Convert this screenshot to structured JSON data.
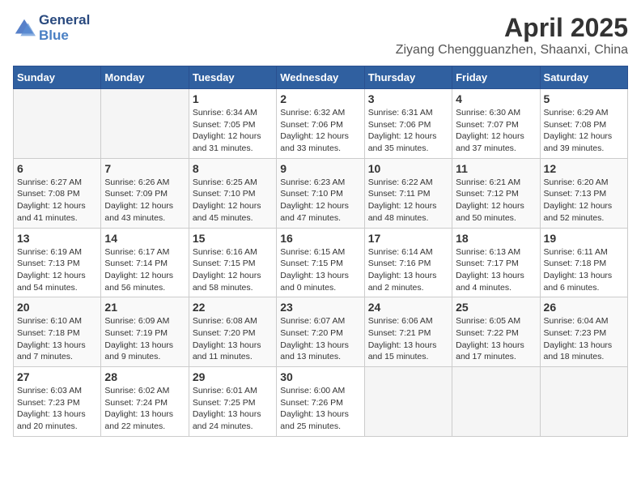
{
  "header": {
    "logo_line1": "General",
    "logo_line2": "Blue",
    "title": "April 2025",
    "subtitle": "Ziyang Chengguanzhen, Shaanxi, China"
  },
  "weekdays": [
    "Sunday",
    "Monday",
    "Tuesday",
    "Wednesday",
    "Thursday",
    "Friday",
    "Saturday"
  ],
  "weeks": [
    [
      {
        "day": "",
        "sunrise": "",
        "sunset": "",
        "daylight": ""
      },
      {
        "day": "",
        "sunrise": "",
        "sunset": "",
        "daylight": ""
      },
      {
        "day": "1",
        "sunrise": "Sunrise: 6:34 AM",
        "sunset": "Sunset: 7:05 PM",
        "daylight": "Daylight: 12 hours and 31 minutes."
      },
      {
        "day": "2",
        "sunrise": "Sunrise: 6:32 AM",
        "sunset": "Sunset: 7:06 PM",
        "daylight": "Daylight: 12 hours and 33 minutes."
      },
      {
        "day": "3",
        "sunrise": "Sunrise: 6:31 AM",
        "sunset": "Sunset: 7:06 PM",
        "daylight": "Daylight: 12 hours and 35 minutes."
      },
      {
        "day": "4",
        "sunrise": "Sunrise: 6:30 AM",
        "sunset": "Sunset: 7:07 PM",
        "daylight": "Daylight: 12 hours and 37 minutes."
      },
      {
        "day": "5",
        "sunrise": "Sunrise: 6:29 AM",
        "sunset": "Sunset: 7:08 PM",
        "daylight": "Daylight: 12 hours and 39 minutes."
      }
    ],
    [
      {
        "day": "6",
        "sunrise": "Sunrise: 6:27 AM",
        "sunset": "Sunset: 7:08 PM",
        "daylight": "Daylight: 12 hours and 41 minutes."
      },
      {
        "day": "7",
        "sunrise": "Sunrise: 6:26 AM",
        "sunset": "Sunset: 7:09 PM",
        "daylight": "Daylight: 12 hours and 43 minutes."
      },
      {
        "day": "8",
        "sunrise": "Sunrise: 6:25 AM",
        "sunset": "Sunset: 7:10 PM",
        "daylight": "Daylight: 12 hours and 45 minutes."
      },
      {
        "day": "9",
        "sunrise": "Sunrise: 6:23 AM",
        "sunset": "Sunset: 7:10 PM",
        "daylight": "Daylight: 12 hours and 47 minutes."
      },
      {
        "day": "10",
        "sunrise": "Sunrise: 6:22 AM",
        "sunset": "Sunset: 7:11 PM",
        "daylight": "Daylight: 12 hours and 48 minutes."
      },
      {
        "day": "11",
        "sunrise": "Sunrise: 6:21 AM",
        "sunset": "Sunset: 7:12 PM",
        "daylight": "Daylight: 12 hours and 50 minutes."
      },
      {
        "day": "12",
        "sunrise": "Sunrise: 6:20 AM",
        "sunset": "Sunset: 7:13 PM",
        "daylight": "Daylight: 12 hours and 52 minutes."
      }
    ],
    [
      {
        "day": "13",
        "sunrise": "Sunrise: 6:19 AM",
        "sunset": "Sunset: 7:13 PM",
        "daylight": "Daylight: 12 hours and 54 minutes."
      },
      {
        "day": "14",
        "sunrise": "Sunrise: 6:17 AM",
        "sunset": "Sunset: 7:14 PM",
        "daylight": "Daylight: 12 hours and 56 minutes."
      },
      {
        "day": "15",
        "sunrise": "Sunrise: 6:16 AM",
        "sunset": "Sunset: 7:15 PM",
        "daylight": "Daylight: 12 hours and 58 minutes."
      },
      {
        "day": "16",
        "sunrise": "Sunrise: 6:15 AM",
        "sunset": "Sunset: 7:15 PM",
        "daylight": "Daylight: 13 hours and 0 minutes."
      },
      {
        "day": "17",
        "sunrise": "Sunrise: 6:14 AM",
        "sunset": "Sunset: 7:16 PM",
        "daylight": "Daylight: 13 hours and 2 minutes."
      },
      {
        "day": "18",
        "sunrise": "Sunrise: 6:13 AM",
        "sunset": "Sunset: 7:17 PM",
        "daylight": "Daylight: 13 hours and 4 minutes."
      },
      {
        "day": "19",
        "sunrise": "Sunrise: 6:11 AM",
        "sunset": "Sunset: 7:18 PM",
        "daylight": "Daylight: 13 hours and 6 minutes."
      }
    ],
    [
      {
        "day": "20",
        "sunrise": "Sunrise: 6:10 AM",
        "sunset": "Sunset: 7:18 PM",
        "daylight": "Daylight: 13 hours and 7 minutes."
      },
      {
        "day": "21",
        "sunrise": "Sunrise: 6:09 AM",
        "sunset": "Sunset: 7:19 PM",
        "daylight": "Daylight: 13 hours and 9 minutes."
      },
      {
        "day": "22",
        "sunrise": "Sunrise: 6:08 AM",
        "sunset": "Sunset: 7:20 PM",
        "daylight": "Daylight: 13 hours and 11 minutes."
      },
      {
        "day": "23",
        "sunrise": "Sunrise: 6:07 AM",
        "sunset": "Sunset: 7:20 PM",
        "daylight": "Daylight: 13 hours and 13 minutes."
      },
      {
        "day": "24",
        "sunrise": "Sunrise: 6:06 AM",
        "sunset": "Sunset: 7:21 PM",
        "daylight": "Daylight: 13 hours and 15 minutes."
      },
      {
        "day": "25",
        "sunrise": "Sunrise: 6:05 AM",
        "sunset": "Sunset: 7:22 PM",
        "daylight": "Daylight: 13 hours and 17 minutes."
      },
      {
        "day": "26",
        "sunrise": "Sunrise: 6:04 AM",
        "sunset": "Sunset: 7:23 PM",
        "daylight": "Daylight: 13 hours and 18 minutes."
      }
    ],
    [
      {
        "day": "27",
        "sunrise": "Sunrise: 6:03 AM",
        "sunset": "Sunset: 7:23 PM",
        "daylight": "Daylight: 13 hours and 20 minutes."
      },
      {
        "day": "28",
        "sunrise": "Sunrise: 6:02 AM",
        "sunset": "Sunset: 7:24 PM",
        "daylight": "Daylight: 13 hours and 22 minutes."
      },
      {
        "day": "29",
        "sunrise": "Sunrise: 6:01 AM",
        "sunset": "Sunset: 7:25 PM",
        "daylight": "Daylight: 13 hours and 24 minutes."
      },
      {
        "day": "30",
        "sunrise": "Sunrise: 6:00 AM",
        "sunset": "Sunset: 7:26 PM",
        "daylight": "Daylight: 13 hours and 25 minutes."
      },
      {
        "day": "",
        "sunrise": "",
        "sunset": "",
        "daylight": ""
      },
      {
        "day": "",
        "sunrise": "",
        "sunset": "",
        "daylight": ""
      },
      {
        "day": "",
        "sunrise": "",
        "sunset": "",
        "daylight": ""
      }
    ]
  ]
}
